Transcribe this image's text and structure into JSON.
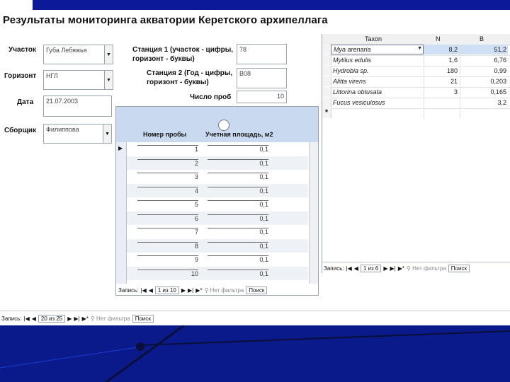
{
  "title": "Результаты мониторинга акватории Керетского архипеллага",
  "fields": {
    "site_label": "Участок",
    "site_value": "Губа Лебяжья",
    "horizon_label": "Горизонт",
    "horizon_value": "НГЛ",
    "date_label": "Дата",
    "date_value": "21.07.2003",
    "collector_label": "Сборщик",
    "collector_value": "Филиппова",
    "station1_label_l1": "Станция 1 (участок - цифры,",
    "station1_label_l2": "горизонт - буквы)",
    "station1_value": "78",
    "station2_label_l1": "Станция 2 (Год - цифры,",
    "station2_label_l2": "горизонт - буквы)",
    "station2_value": "В08",
    "samples_count_label": "Число проб",
    "samples_count_value": "10"
  },
  "samples": {
    "col1": "Номер пробы",
    "col2": "Учетная площадь, м2",
    "rows": [
      {
        "num": "1",
        "area": "0,1"
      },
      {
        "num": "2",
        "area": "0,1"
      },
      {
        "num": "3",
        "area": "0,1"
      },
      {
        "num": "4",
        "area": "0,1"
      },
      {
        "num": "5",
        "area": "0,1"
      },
      {
        "num": "6",
        "area": "0,1"
      },
      {
        "num": "7",
        "area": "0,1"
      },
      {
        "num": "8",
        "area": "0,1"
      },
      {
        "num": "9",
        "area": "0,1"
      },
      {
        "num": "10",
        "area": "0,1"
      }
    ],
    "nav": {
      "label": "Запись:",
      "position": "1 из 10",
      "filter": "Нет фильтра",
      "search": "Поиск"
    }
  },
  "taxa": {
    "col_taxon": "Taxon",
    "col_n": "N",
    "col_b": "B",
    "rows": [
      {
        "taxon": "Mya arenaria",
        "n": "8,2",
        "b": "51,2"
      },
      {
        "taxon": "Mytilus edulis",
        "n": "1,6",
        "b": "6,76"
      },
      {
        "taxon": "Hydrobia sp.",
        "n": "180",
        "b": "0,99"
      },
      {
        "taxon": "Alitta virens",
        "n": "21",
        "b": "0,203"
      },
      {
        "taxon": "Littorina obtusata",
        "n": "3",
        "b": "0,165"
      },
      {
        "taxon": "Fucus vesiculosus",
        "n": "",
        "b": "3,2"
      }
    ],
    "new_row_marker": "*",
    "nav": {
      "label": "Запись:",
      "position": "1 из 6",
      "filter": "Нет фильтра",
      "search": "Поиск"
    }
  },
  "main_nav": {
    "label": "Запись:",
    "position": "20 из 25",
    "filter": "Нет фильтра",
    "search": "Поиск"
  },
  "colors": {
    "header_fill": "#c9d9ef",
    "background": "#0b1a8a",
    "selected_row": "#cfe0f5"
  }
}
